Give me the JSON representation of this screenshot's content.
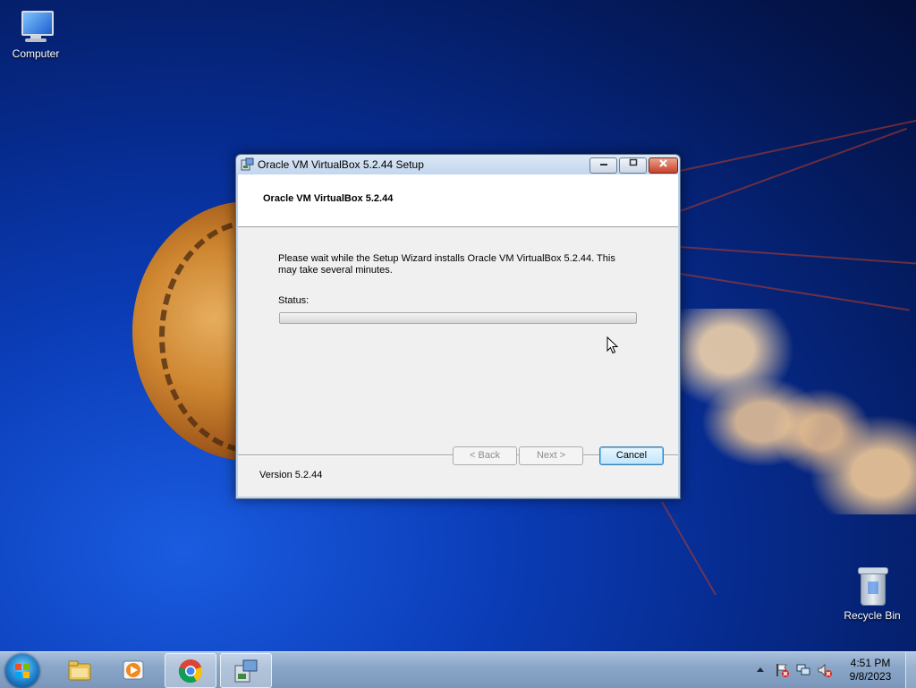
{
  "desktop": {
    "icons": [
      {
        "label": "Computer"
      },
      {
        "label": "Recycle Bin"
      }
    ]
  },
  "dialog": {
    "title": "Oracle VM VirtualBox 5.2.44 Setup",
    "banner_title": "Oracle VM VirtualBox 5.2.44",
    "message": "Please wait while the Setup Wizard installs Oracle VM VirtualBox 5.2.44. This may take several minutes.",
    "status_label": "Status:",
    "progress_percent": 0,
    "version": "Version 5.2.44",
    "buttons": {
      "back": "< Back",
      "next": "Next >",
      "cancel": "Cancel"
    },
    "controls": {
      "minimize": "minimize-icon",
      "maximize": "maximize-icon",
      "close": "close-icon"
    }
  },
  "taskbar": {
    "pinned": [
      "windows-explorer-icon",
      "media-player-icon",
      "chrome-icon",
      "virtualbox-setup-icon"
    ],
    "clock": {
      "time": "4:51 PM",
      "date": "9/8/2023"
    },
    "tray": [
      "show-hidden-icons-arrow",
      "action-center-flag-icon",
      "network-icon",
      "volume-muted-icon"
    ]
  },
  "colors": {
    "desktop_blue": "#0b3db8",
    "dialog_frame": "#bfd3ea",
    "close_red": "#c7412a",
    "progress_green": "#2fb02f"
  }
}
